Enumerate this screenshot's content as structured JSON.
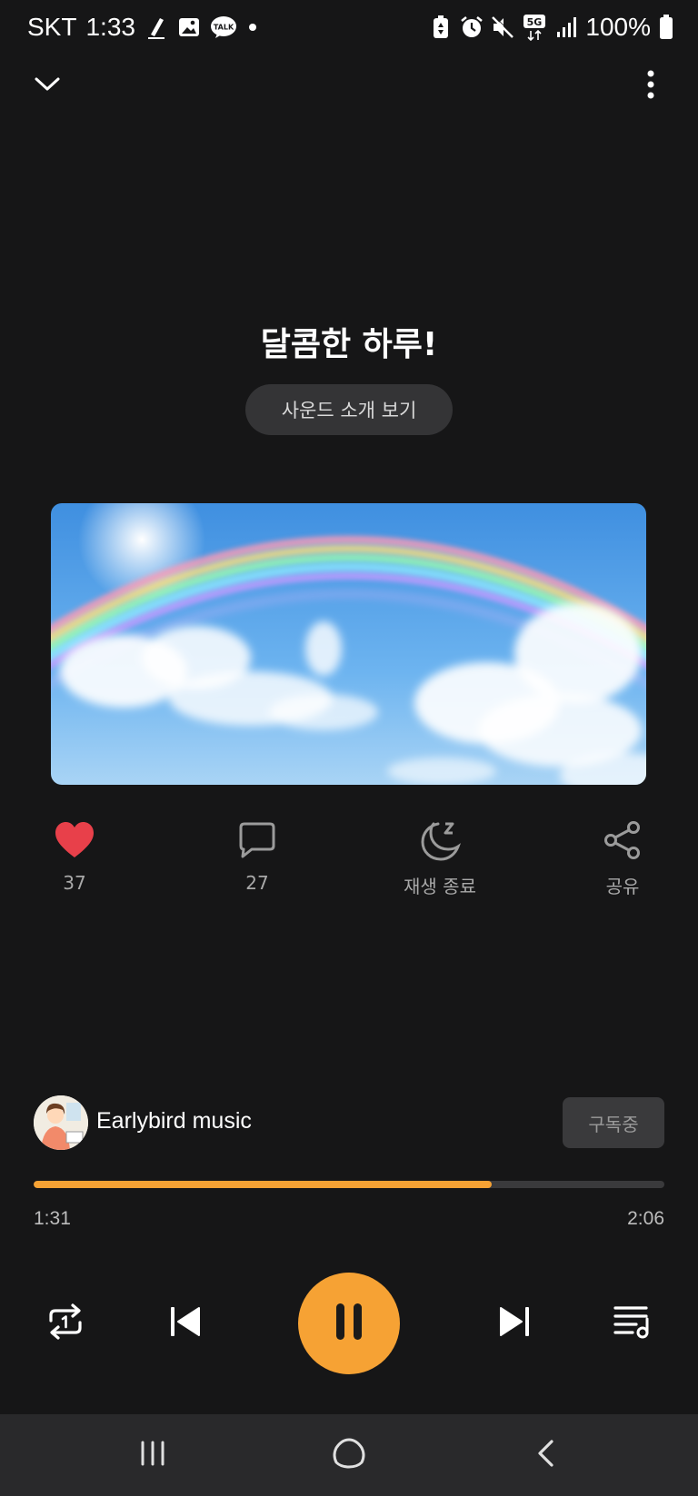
{
  "status_bar": {
    "carrier": "SKT",
    "time": "1:33",
    "notification_icons": [
      "pen-icon",
      "image-icon",
      "kakaotalk-icon",
      "dot-icon"
    ],
    "kakaotalk_label": "TALK",
    "system_icons": [
      "battery-saver-icon",
      "alarm-icon",
      "mute-icon",
      "5g-icon",
      "signal-icon"
    ],
    "network_label": "5G",
    "battery": "100%"
  },
  "top_bar": {
    "collapse_icon": "chevron-down-icon",
    "menu_icon": "more-vertical-icon"
  },
  "track": {
    "title": "달콤한 하루!",
    "intro_button": "사운드 소개 보기",
    "artwork": "rainbow-sky-image"
  },
  "actions": {
    "like": {
      "icon": "heart-icon",
      "label": "37",
      "active": true,
      "color": "#e8404a"
    },
    "comment": {
      "icon": "comment-icon",
      "label": "27"
    },
    "sleep_timer": {
      "icon": "moon-sleep-icon",
      "label": "재생 종료"
    },
    "share": {
      "icon": "share-icon",
      "label": "공유"
    }
  },
  "channel": {
    "name": "Earlybird music",
    "subscribe_button": "구독중"
  },
  "player": {
    "elapsed": "1:31",
    "duration": "2:06",
    "progress": 0.7258,
    "accent_color": "#f6a234",
    "controls": [
      "repeat-one-icon",
      "previous-icon",
      "pause-icon",
      "next-icon",
      "playlist-icon"
    ]
  },
  "nav_bar": {
    "buttons": [
      "recent-apps-icon",
      "home-icon",
      "back-icon"
    ]
  }
}
